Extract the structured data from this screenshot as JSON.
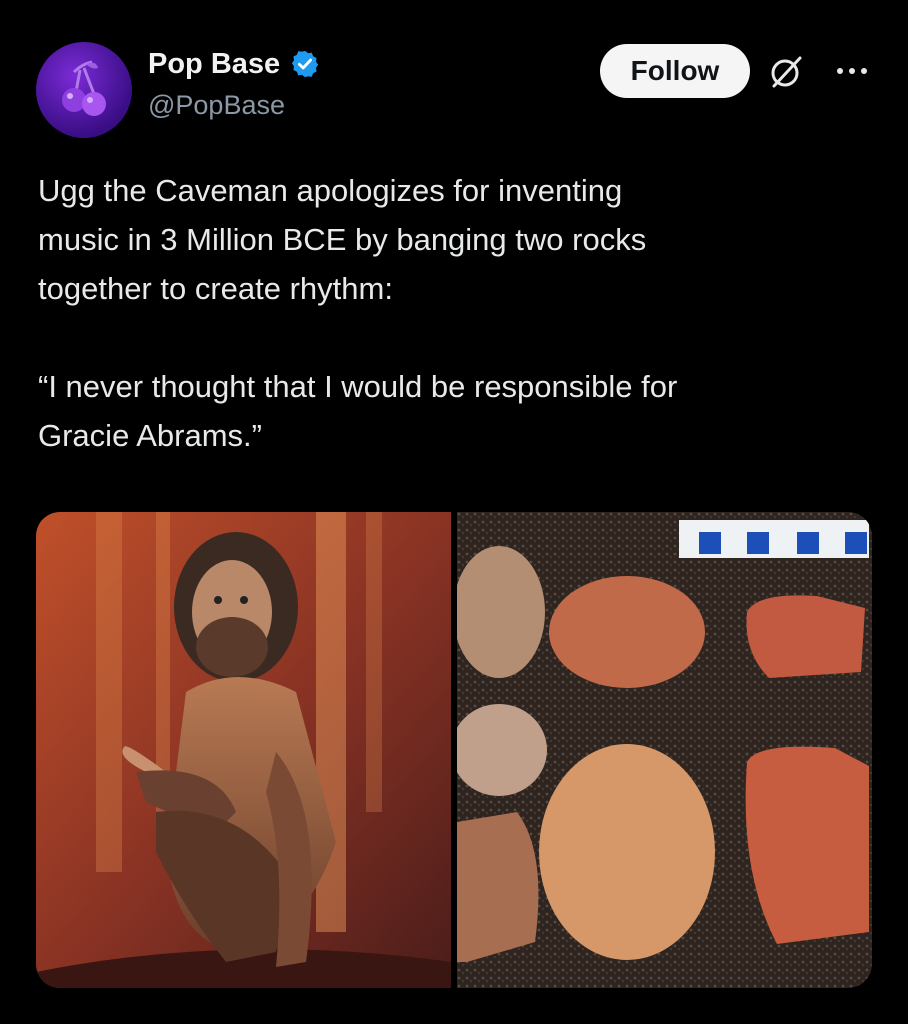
{
  "tweet": {
    "display_name": "Pop Base",
    "handle": "@PopBase",
    "verified_icon": "verified-badge-icon",
    "follow_label": "Follow",
    "grok_icon": "grok-icon",
    "more_icon": "more-options-icon",
    "text": "Ugg the Caveman apologizes for inventing\nmusic in 3 Million BCE by banging two rocks\ntogether to create rhythm:\n\n“I never thought that I would be responsible for\nGracie Abrams.”"
  },
  "media": {
    "left_image": "caveman-photo",
    "right_image": "rocks-photo"
  },
  "colors": {
    "background": "#000000",
    "text": "#e7e9ea",
    "handle": "#8b98a5",
    "verified_blue": "#1d9bf0",
    "follow_bg": "#f5f5f5"
  }
}
